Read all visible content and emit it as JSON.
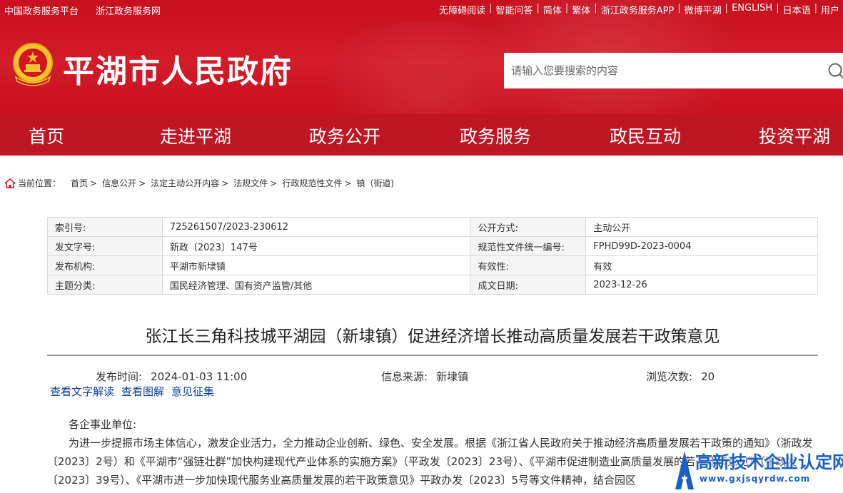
{
  "topbar": {
    "left_links": [
      "中国政务服务平台",
      "浙江政务服务网"
    ],
    "right_links": [
      "无障碍阅读",
      "智能问答",
      "简体",
      "繁体",
      "浙江政务服务APP",
      "微博平湖",
      "ENGLISH",
      "日本语",
      "用户"
    ]
  },
  "header": {
    "site_title": "平湖市人民政府",
    "search_placeholder": "请输入您要搜索的内容"
  },
  "nav": {
    "items": [
      "首页",
      "走进平湖",
      "政务公开",
      "政务服务",
      "政民互动",
      "投资平湖"
    ]
  },
  "breadcrumb": {
    "label": "当前位置：",
    "items": [
      "首页",
      "信息公开",
      "法定主动公开内容",
      "法规文件",
      "行政规范性文件",
      "镇（街道)"
    ]
  },
  "info_table": {
    "rows": [
      {
        "k1": "索引号:",
        "v1": "725261507/2023-230612",
        "k2": "公开方式:",
        "v2": "主动公开"
      },
      {
        "k1": "发文字号:",
        "v1": "新政〔2023〕147号",
        "k2": "规范性文件统一编号:",
        "v2": "FPHD99D-2023-0004"
      },
      {
        "k1": "发布机构:",
        "v1": "平湖市新埭镇",
        "k2": "有效性:",
        "v2": "有效"
      },
      {
        "k1": "主题分类:",
        "v1": "国民经济管理、国有资产监管/其他",
        "k2": "成文日期:",
        "v2": "2023-12-26"
      }
    ]
  },
  "article": {
    "title": "张江长三角科技城平湖园（新埭镇）促进经济增长推动高质量发展若干政策意见",
    "publish_label": "发布时间:",
    "publish_value": "2024-01-03 11:00",
    "source_label": "信息来源:",
    "source_value": "新埭镇",
    "views_label": "浏览次数:",
    "views_value": "20",
    "links": [
      "查看文字解读",
      "查看图解",
      "意见征集"
    ],
    "greeting": "各企事业单位:",
    "paragraph": "为进一步提振市场主体信心，激发企业活力，全力推动企业创新、绿色、安全发展。根据《浙江省人民政府关于推动经济高质量发展若干政策的通知》（浙政发〔2023〕2号）和《平湖市“强链壮群”加快构建现代产业体系的实施方案》（平政发〔2023〕23号）、《平湖市促进制造业高质量发展的若干政策意见》（平政发〔2023〕39号）、《平湖市进一步加快现代服务业高质量发展的若干政策意见》平政办发〔2023〕5号等文件精神，结合园区"
  },
  "watermark": {
    "text": "高新技术企业认定网",
    "url": "www.gxjsqyrdw.com"
  }
}
